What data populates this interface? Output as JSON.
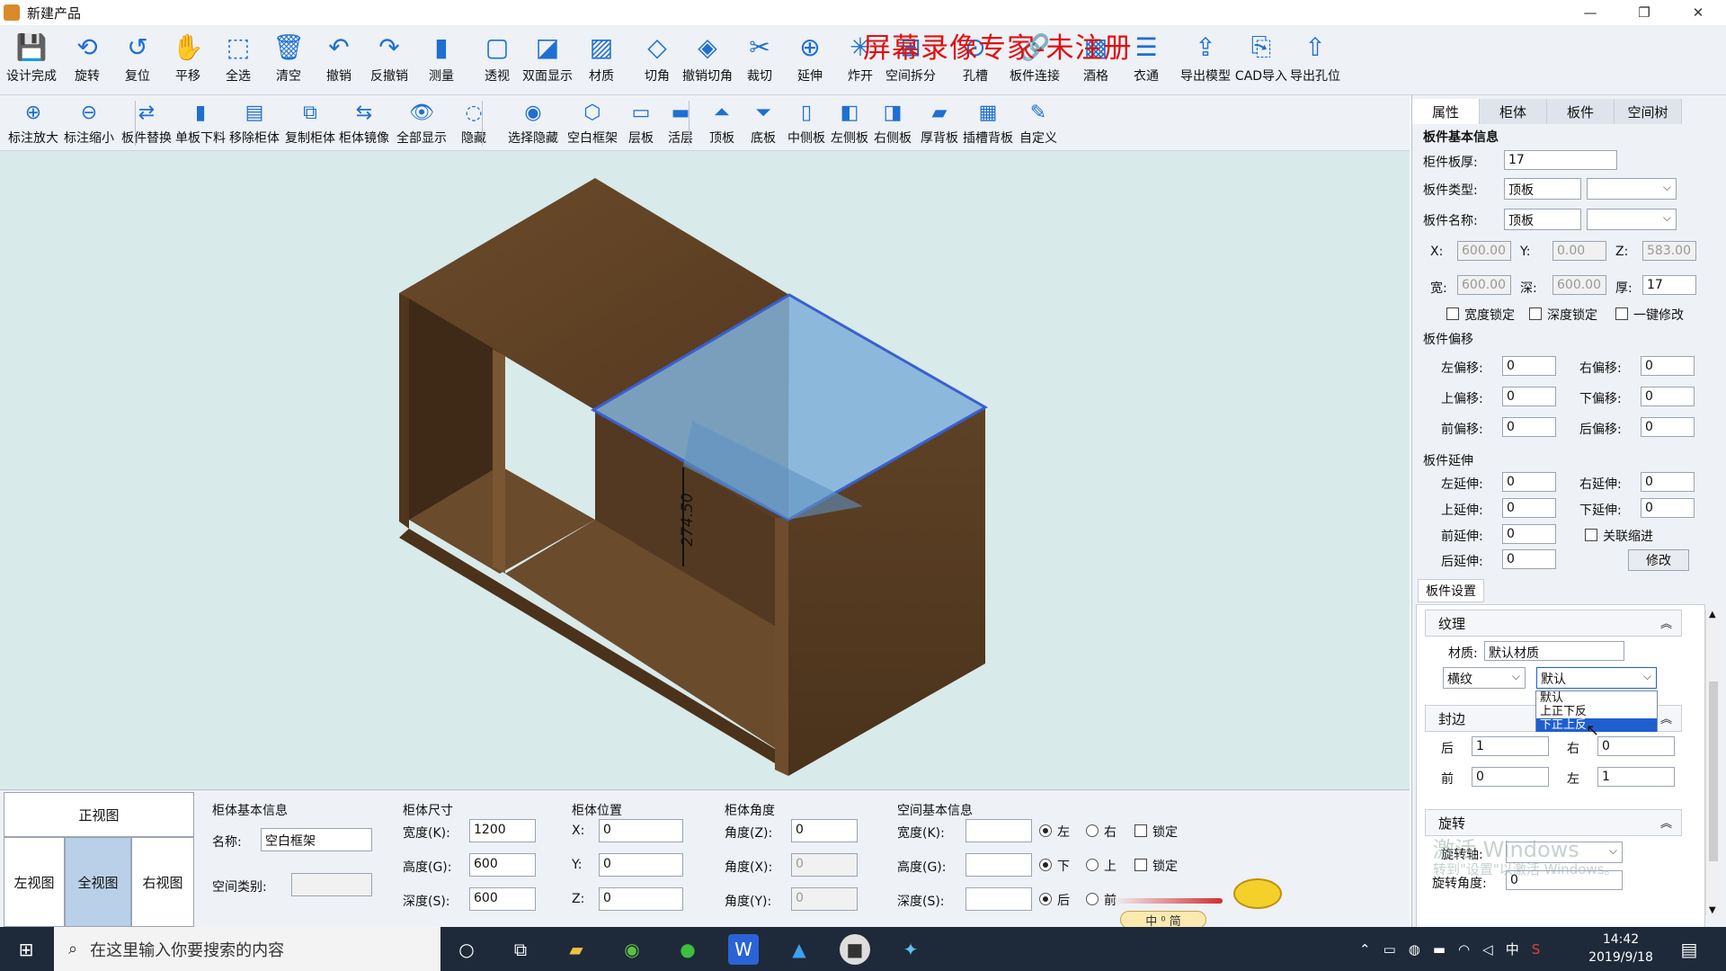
{
  "window": {
    "title": "新建产品",
    "minimize": "—",
    "restore": "❐",
    "close": "✕"
  },
  "watermark": "屏幕录像专家-未注册",
  "toolbar1": [
    {
      "label": "设计完成",
      "icon": "save-icon"
    },
    {
      "label": "旋转",
      "icon": "rotate-icon"
    },
    {
      "label": "复位",
      "icon": "reset-icon"
    },
    {
      "label": "平移",
      "icon": "hand-icon"
    },
    {
      "label": "全选",
      "icon": "select-all-icon"
    },
    {
      "label": "清空",
      "icon": "trash-icon"
    },
    {
      "label": "撤销",
      "icon": "undo-icon"
    },
    {
      "label": "反撤销",
      "icon": "redo-icon"
    },
    {
      "label": "测量",
      "icon": "measure-icon"
    },
    {
      "label": "透视",
      "icon": "perspective-icon"
    },
    {
      "label": "双面显示",
      "icon": "double-side-icon"
    },
    {
      "label": "材质",
      "icon": "material-icon"
    },
    {
      "label": "切角",
      "icon": "chamfer-icon"
    },
    {
      "label": "撤销切角",
      "icon": "undo-chamfer-icon"
    },
    {
      "label": "裁切",
      "icon": "cut-icon"
    },
    {
      "label": "延伸",
      "icon": "extend-icon"
    },
    {
      "label": "炸开",
      "icon": "explode-icon"
    },
    {
      "label": "空间拆分",
      "icon": "space-split-icon"
    },
    {
      "label": "孔槽",
      "icon": "hole-slot-icon"
    },
    {
      "label": "板件连接",
      "icon": "board-link-icon"
    },
    {
      "label": "酒格",
      "icon": "wine-rack-icon"
    },
    {
      "label": "衣通",
      "icon": "hanger-rod-icon"
    },
    {
      "label": "导出模型",
      "icon": "export-model-icon"
    },
    {
      "label": "CAD导入",
      "icon": "cad-import-icon"
    },
    {
      "label": "导出孔位",
      "icon": "export-holes-icon"
    }
  ],
  "toolbar2": [
    {
      "label": "标注放大",
      "icon": "zoom-in-icon"
    },
    {
      "label": "标注缩小",
      "icon": "zoom-out-icon"
    },
    {
      "label": "板件替换",
      "icon": "replace-board-icon"
    },
    {
      "label": "单板下料",
      "icon": "single-board-icon"
    },
    {
      "label": "移除柜体",
      "icon": "remove-cabinet-icon"
    },
    {
      "label": "复制柜体",
      "icon": "copy-cabinet-icon"
    },
    {
      "label": "柜体镜像",
      "icon": "mirror-cabinet-icon"
    },
    {
      "label": "全部显示",
      "icon": "eye-icon"
    },
    {
      "label": "隐藏",
      "icon": "hide-icon"
    },
    {
      "label": "选择隐藏",
      "icon": "select-hide-icon"
    },
    {
      "label": "空白框架",
      "icon": "blank-frame-icon"
    },
    {
      "label": "层板",
      "icon": "shelf-icon"
    },
    {
      "label": "活层",
      "icon": "movable-shelf-icon"
    },
    {
      "label": "顶板",
      "icon": "top-board-icon"
    },
    {
      "label": "底板",
      "icon": "bottom-board-icon"
    },
    {
      "label": "中侧板",
      "icon": "middle-side-icon"
    },
    {
      "label": "左侧板",
      "icon": "left-side-icon"
    },
    {
      "label": "右侧板",
      "icon": "right-side-icon"
    },
    {
      "label": "厚背板",
      "icon": "thick-back-icon"
    },
    {
      "label": "插槽背板",
      "icon": "slot-back-icon"
    },
    {
      "label": "自定义",
      "icon": "custom-icon"
    }
  ],
  "dimension_label": "274.50",
  "right_panel": {
    "tabs": [
      "属性",
      "柜体",
      "板件",
      "空间树"
    ],
    "basic_title": "板件基本信息",
    "thickness_label": "柜件板厚:",
    "thickness_value": "17",
    "type_label": "板件类型:",
    "type_value": "顶板",
    "name_label": "板件名称:",
    "name_value": "顶板",
    "x_label": "X:",
    "x_value": "600.00",
    "y_label": "Y:",
    "y_value": "0.00",
    "z_label": "Z:",
    "z_value": "583.00",
    "w_label": "宽:",
    "w_value": "600.00",
    "d_label": "深:",
    "d_value": "600.00",
    "t_label": "厚:",
    "t_value": "17",
    "width_lock": "宽度锁定",
    "depth_lock": "深度锁定",
    "one_key": "一键修改",
    "offset_title": "板件偏移",
    "offsets": [
      {
        "label": "左偏移:",
        "value": "0"
      },
      {
        "label": "右偏移:",
        "value": "0"
      },
      {
        "label": "上偏移:",
        "value": "0"
      },
      {
        "label": "下偏移:",
        "value": "0"
      },
      {
        "label": "前偏移:",
        "value": "0"
      },
      {
        "label": "后偏移:",
        "value": "0"
      }
    ],
    "extend_title": "板件延伸",
    "extends": [
      {
        "label": "左延伸:",
        "value": "0"
      },
      {
        "label": "右延伸:",
        "value": "0"
      },
      {
        "label": "上延伸:",
        "value": "0"
      },
      {
        "label": "下延伸:",
        "value": "0"
      },
      {
        "label": "前延伸:",
        "value": "0"
      }
    ],
    "link_indent": "关联缩进",
    "back_extend_label": "后延伸:",
    "back_extend_value": "0",
    "modify_btn": "修改",
    "settings_title": "板件设置",
    "texture_title": "纹理",
    "material_label": "材质:",
    "material_value": "默认材质",
    "grain_value": "横纹",
    "texture_dir_value": "默认",
    "dropdown_options": [
      "默认",
      "上正下反",
      "下正上反"
    ],
    "edge_title": "封边",
    "edge_back_label": "后",
    "edge_back_value": "1",
    "edge_right_label": "右",
    "edge_right_value": "0",
    "edge_front_label": "前",
    "edge_front_value": "0",
    "edge_left_label": "左",
    "edge_left_value": "1",
    "rotate_title": "旋转",
    "rotate_axis_label": "旋转轴:",
    "rotate_angle_label": "旋转角度:",
    "rotate_angle_value": "0",
    "activate_line1": "激活 Windows",
    "activate_line2": "转到\"设置\"以激活 Windows。"
  },
  "bottom_panel": {
    "views": {
      "front": "正视图",
      "left": "左视图",
      "full": "全视图",
      "right": "右视图"
    },
    "cab_title": "柜体基本信息",
    "name_label": "名称:",
    "name_value": "空白框架",
    "space_type_label": "空间类别:",
    "size_title": "柜体尺寸",
    "width_label": "宽度(K):",
    "width_value": "1200",
    "height_label": "高度(G):",
    "height_value": "600",
    "depth_label": "深度(S):",
    "depth_value": "600",
    "pos_title": "柜体位置",
    "px_label": "X:",
    "px_value": "0",
    "py_label": "Y:",
    "py_value": "0",
    "pz_label": "Z:",
    "pz_value": "0",
    "angle_title": "柜体角度",
    "az_label": "角度(Z):",
    "az_value": "0",
    "ax_label": "角度(X):",
    "ax_value": "0",
    "ay_label": "角度(Y):",
    "ay_value": "0",
    "space_title": "空间基本信息",
    "sw_label": "宽度(K):",
    "sh_label": "高度(G):",
    "sd_label": "深度(S):",
    "left": "左",
    "right": "右",
    "down": "下",
    "up": "上",
    "back": "后",
    "front": "前",
    "lock": "锁定",
    "ime": "中 ⁰ 简"
  },
  "taskbar": {
    "search_placeholder": "在这里输入你要搜索的内容",
    "time": "14:42",
    "date": "2019/9/18",
    "ime_lang": "中"
  }
}
